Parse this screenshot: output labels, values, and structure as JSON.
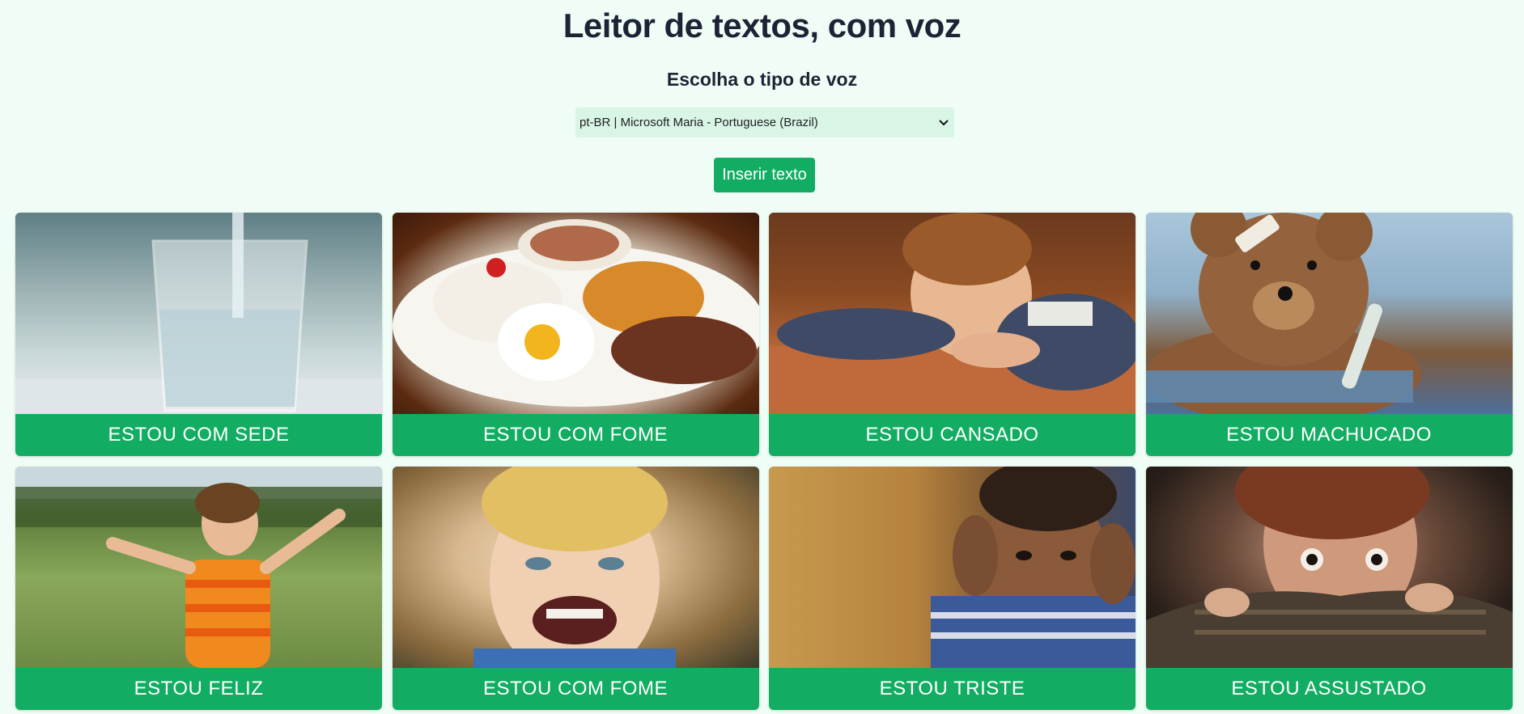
{
  "header": {
    "title": "Leitor de textos, com voz",
    "subtitle": "Escolha o tipo de voz"
  },
  "voice_select": {
    "selected": "pt-BR | Microsoft Maria - Portuguese (Brazil)"
  },
  "insert_button": {
    "label": "Inserir texto"
  },
  "cards": [
    {
      "label": "ESTOU COM SEDE",
      "image": "glass-of-water"
    },
    {
      "label": "ESTOU COM FOME",
      "image": "plate-of-food"
    },
    {
      "label": "ESTOU CANSADO",
      "image": "sleeping-child"
    },
    {
      "label": "ESTOU MACHUCADO",
      "image": "injured-teddy-bear"
    },
    {
      "label": "ESTOU FELIZ",
      "image": "happy-child-in-field"
    },
    {
      "label": "ESTOU COM FOME",
      "image": "angry-child"
    },
    {
      "label": "ESTOU TRISTE",
      "image": "sad-child"
    },
    {
      "label": "ESTOU ASSUSTADO",
      "image": "scared-child"
    }
  ],
  "colors": {
    "background": "#f0fdf6",
    "accent": "#12ad62",
    "select_bg": "#d8f5e6",
    "text": "#1e2235"
  }
}
